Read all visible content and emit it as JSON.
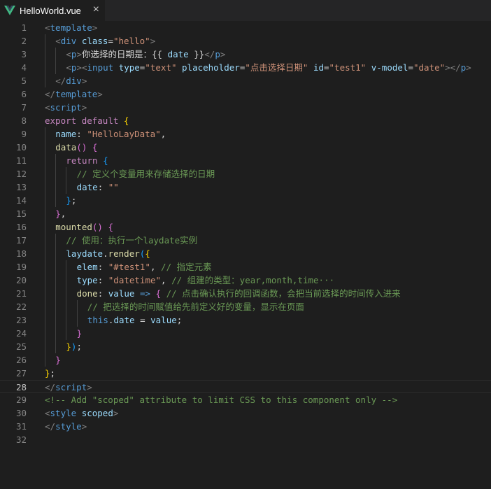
{
  "tab": {
    "title": "HelloWorld.vue",
    "close": "×",
    "icon": "vue-logo-icon"
  },
  "colors": {
    "tag": "#569cd6",
    "string": "#ce9178",
    "attr": "#9cdcfe",
    "comment": "#6a9955",
    "keyword": "#c586c0"
  },
  "current_line": 28,
  "lines": [
    {
      "n": "1",
      "indent": 0,
      "tokens": [
        [
          "t-bracket",
          "<"
        ],
        [
          "t-tag",
          "template"
        ],
        [
          "t-bracket",
          ">"
        ]
      ]
    },
    {
      "n": "2",
      "indent": 1,
      "tokens": [
        [
          "t-bracket",
          "<"
        ],
        [
          "t-tag",
          "div"
        ],
        [
          "t-plain",
          " "
        ],
        [
          "t-attr",
          "class"
        ],
        [
          "t-plain",
          "="
        ],
        [
          "t-str",
          "\"hello\""
        ],
        [
          "t-bracket",
          ">"
        ]
      ]
    },
    {
      "n": "3",
      "indent": 2,
      "tokens": [
        [
          "t-bracket",
          "<"
        ],
        [
          "t-tag",
          "p"
        ],
        [
          "t-bracket",
          ">"
        ],
        [
          "t-text",
          "你选择的日期是：{{ "
        ],
        [
          "t-attr",
          "date"
        ],
        [
          "t-text",
          " }}"
        ],
        [
          "t-bracket",
          "</"
        ],
        [
          "t-tag",
          "p"
        ],
        [
          "t-bracket",
          ">"
        ]
      ]
    },
    {
      "n": "4",
      "indent": 2,
      "tokens": [
        [
          "t-bracket",
          "<"
        ],
        [
          "t-tag",
          "p"
        ],
        [
          "t-bracket",
          "><"
        ],
        [
          "t-tag",
          "input"
        ],
        [
          "t-plain",
          " "
        ],
        [
          "t-attr",
          "type"
        ],
        [
          "t-plain",
          "="
        ],
        [
          "t-str",
          "\"text\""
        ],
        [
          "t-plain",
          " "
        ],
        [
          "t-attr",
          "placeholder"
        ],
        [
          "t-plain",
          "="
        ],
        [
          "t-str",
          "\"点击选择日期\""
        ],
        [
          "t-plain",
          " "
        ],
        [
          "t-attr",
          "id"
        ],
        [
          "t-plain",
          "="
        ],
        [
          "t-str",
          "\"test1\""
        ],
        [
          "t-plain",
          " "
        ],
        [
          "t-attr",
          "v-model"
        ],
        [
          "t-plain",
          "="
        ],
        [
          "t-str",
          "\"date\""
        ],
        [
          "t-bracket",
          "></"
        ],
        [
          "t-tag",
          "p"
        ],
        [
          "t-bracket",
          ">"
        ]
      ]
    },
    {
      "n": "5",
      "indent": 1,
      "tokens": [
        [
          "t-bracket",
          "</"
        ],
        [
          "t-tag",
          "div"
        ],
        [
          "t-bracket",
          ">"
        ]
      ]
    },
    {
      "n": "6",
      "indent": 0,
      "tokens": [
        [
          "t-bracket",
          "</"
        ],
        [
          "t-tag",
          "template"
        ],
        [
          "t-bracket",
          ">"
        ]
      ]
    },
    {
      "n": "7",
      "indent": 0,
      "tokens": [
        [
          "t-bracket",
          "<"
        ],
        [
          "t-tag",
          "script"
        ],
        [
          "t-bracket",
          ">"
        ]
      ]
    },
    {
      "n": "8",
      "indent": 0,
      "tokens": [
        [
          "t-kw",
          "export"
        ],
        [
          "t-plain",
          " "
        ],
        [
          "t-kw",
          "default"
        ],
        [
          "t-plain",
          " "
        ],
        [
          "t-brace",
          "{"
        ]
      ]
    },
    {
      "n": "9",
      "indent": 1,
      "tokens": [
        [
          "t-prop",
          "name"
        ],
        [
          "t-plain",
          ": "
        ],
        [
          "t-str",
          "\"HelloLayData\""
        ],
        [
          "t-plain",
          ","
        ]
      ]
    },
    {
      "n": "10",
      "indent": 1,
      "tokens": [
        [
          "t-fn",
          "data"
        ],
        [
          "t-brace2",
          "()"
        ],
        [
          "t-plain",
          " "
        ],
        [
          "t-brace2",
          "{"
        ]
      ]
    },
    {
      "n": "11",
      "indent": 2,
      "tokens": [
        [
          "t-kw",
          "return"
        ],
        [
          "t-plain",
          " "
        ],
        [
          "t-brace3",
          "{"
        ]
      ]
    },
    {
      "n": "12",
      "indent": 3,
      "tokens": [
        [
          "t-com",
          "// 定义个变量用来存储选择的日期"
        ]
      ]
    },
    {
      "n": "13",
      "indent": 3,
      "tokens": [
        [
          "t-prop",
          "date"
        ],
        [
          "t-plain",
          ": "
        ],
        [
          "t-str",
          "\"\""
        ]
      ]
    },
    {
      "n": "14",
      "indent": 2,
      "tokens": [
        [
          "t-brace3",
          "}"
        ],
        [
          "t-plain",
          ";"
        ]
      ]
    },
    {
      "n": "15",
      "indent": 1,
      "tokens": [
        [
          "t-brace2",
          "}"
        ],
        [
          "t-plain",
          ","
        ]
      ]
    },
    {
      "n": "16",
      "indent": 1,
      "tokens": [
        [
          "t-fn",
          "mounted"
        ],
        [
          "t-brace2",
          "()"
        ],
        [
          "t-plain",
          " "
        ],
        [
          "t-brace2",
          "{"
        ]
      ]
    },
    {
      "n": "17",
      "indent": 2,
      "tokens": [
        [
          "t-com",
          "// 使用：执行一个laydate实例"
        ]
      ]
    },
    {
      "n": "18",
      "indent": 2,
      "tokens": [
        [
          "t-prop",
          "laydate"
        ],
        [
          "t-plain",
          "."
        ],
        [
          "t-fn",
          "render"
        ],
        [
          "t-brace3",
          "("
        ],
        [
          "t-brace",
          "{"
        ]
      ]
    },
    {
      "n": "19",
      "indent": 3,
      "tokens": [
        [
          "t-prop",
          "elem"
        ],
        [
          "t-plain",
          ": "
        ],
        [
          "t-str",
          "\"#test1\""
        ],
        [
          "t-plain",
          ", "
        ],
        [
          "t-com",
          "// 指定元素"
        ]
      ]
    },
    {
      "n": "20",
      "indent": 3,
      "tokens": [
        [
          "t-prop",
          "type"
        ],
        [
          "t-plain",
          ": "
        ],
        [
          "t-str",
          "\"datetime\""
        ],
        [
          "t-plain",
          ", "
        ],
        [
          "t-com",
          "// 组建的类型：year,month,time···"
        ]
      ]
    },
    {
      "n": "21",
      "indent": 3,
      "tokens": [
        [
          "t-fn",
          "done"
        ],
        [
          "t-plain",
          ": "
        ],
        [
          "t-attr",
          "value"
        ],
        [
          "t-plain",
          " "
        ],
        [
          "t-tag",
          "=>"
        ],
        [
          "t-plain",
          " "
        ],
        [
          "t-brace2",
          "{"
        ],
        [
          "t-plain",
          " "
        ],
        [
          "t-com",
          "// 点击确认执行的回调函数，会把当前选择的时间传入进来"
        ]
      ]
    },
    {
      "n": "22",
      "indent": 4,
      "tokens": [
        [
          "t-com",
          "// 把选择的时间赋值给先前定义好的变量，显示在页面"
        ]
      ]
    },
    {
      "n": "23",
      "indent": 4,
      "tokens": [
        [
          "t-this",
          "this"
        ],
        [
          "t-plain",
          "."
        ],
        [
          "t-prop",
          "date"
        ],
        [
          "t-plain",
          " = "
        ],
        [
          "t-attr",
          "value"
        ],
        [
          "t-plain",
          ";"
        ]
      ]
    },
    {
      "n": "24",
      "indent": 3,
      "tokens": [
        [
          "t-brace2",
          "}"
        ]
      ]
    },
    {
      "n": "25",
      "indent": 2,
      "tokens": [
        [
          "t-brace",
          "}"
        ],
        [
          "t-brace3",
          ")"
        ],
        [
          "t-plain",
          ";"
        ]
      ]
    },
    {
      "n": "26",
      "indent": 1,
      "tokens": [
        [
          "t-brace2",
          "}"
        ]
      ]
    },
    {
      "n": "27",
      "indent": 0,
      "tokens": [
        [
          "t-brace",
          "}"
        ],
        [
          "t-plain",
          ";"
        ]
      ]
    },
    {
      "n": "28",
      "indent": 0,
      "tokens": [
        [
          "t-bracket",
          "</"
        ],
        [
          "t-tag",
          "script"
        ],
        [
          "t-bracket",
          ">"
        ]
      ]
    },
    {
      "n": "29",
      "indent": 0,
      "tokens": [
        [
          "t-com",
          "<!-- Add \"scoped\" attribute to limit CSS to this component only -->"
        ]
      ]
    },
    {
      "n": "30",
      "indent": 0,
      "tokens": [
        [
          "t-bracket",
          "<"
        ],
        [
          "t-tag",
          "style"
        ],
        [
          "t-plain",
          " "
        ],
        [
          "t-attr",
          "scoped"
        ],
        [
          "t-bracket",
          ">"
        ]
      ]
    },
    {
      "n": "31",
      "indent": 0,
      "tokens": [
        [
          "t-bracket",
          "</"
        ],
        [
          "t-tag",
          "style"
        ],
        [
          "t-bracket",
          ">"
        ]
      ]
    },
    {
      "n": "32",
      "indent": 0,
      "tokens": []
    }
  ]
}
